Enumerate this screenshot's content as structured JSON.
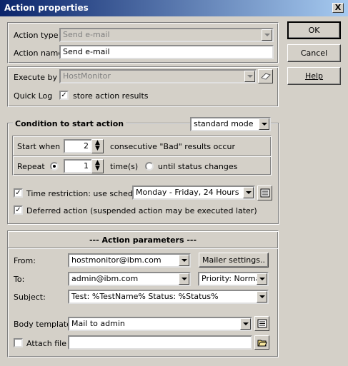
{
  "window": {
    "title": "Action properties",
    "close_glyph": "X"
  },
  "dialog_buttons": {
    "ok": "OK",
    "cancel": "Cancel",
    "help": "Help"
  },
  "action": {
    "type_label": "Action type",
    "type_value": "Send e-mail",
    "name_label": "Action name",
    "name_value": "Send e-mail"
  },
  "execute": {
    "label": "Execute by",
    "value": "HostMonitor",
    "quicklog_label": "Quick Log",
    "store_label": "store action results",
    "store_checked": true
  },
  "condition": {
    "title": "Condition to start action",
    "mode_value": "standard mode",
    "start_label": "Start when",
    "start_value": "2",
    "start_suffix": "consecutive \"Bad\" results occur",
    "repeat_label": "Repeat",
    "repeat_value": "1",
    "repeat_suffix": "time(s)",
    "until_label": "until status changes",
    "time_label": "Time restriction: use schedule",
    "time_checked": true,
    "schedule_value": "Monday - Friday, 24 Hours",
    "deferred_label": "Deferred action (suspended action may be executed later)",
    "deferred_checked": true
  },
  "params": {
    "title": "---   Action parameters   ---",
    "from_label": "From:",
    "from_value": "hostmonitor@ibm.com",
    "mailer_button": "Mailer settings..",
    "to_label": "To:",
    "to_value": "admin@ibm.com",
    "priority_value": "Priority: Normal",
    "subject_label": "Subject:",
    "subject_value": "Test: %TestName%  Status: %Status%",
    "body_label": "Body template",
    "body_value": "Mail to admin",
    "attach_label": "Attach file",
    "attach_value": "",
    "attach_checked": false
  },
  "check_glyph": "✓"
}
